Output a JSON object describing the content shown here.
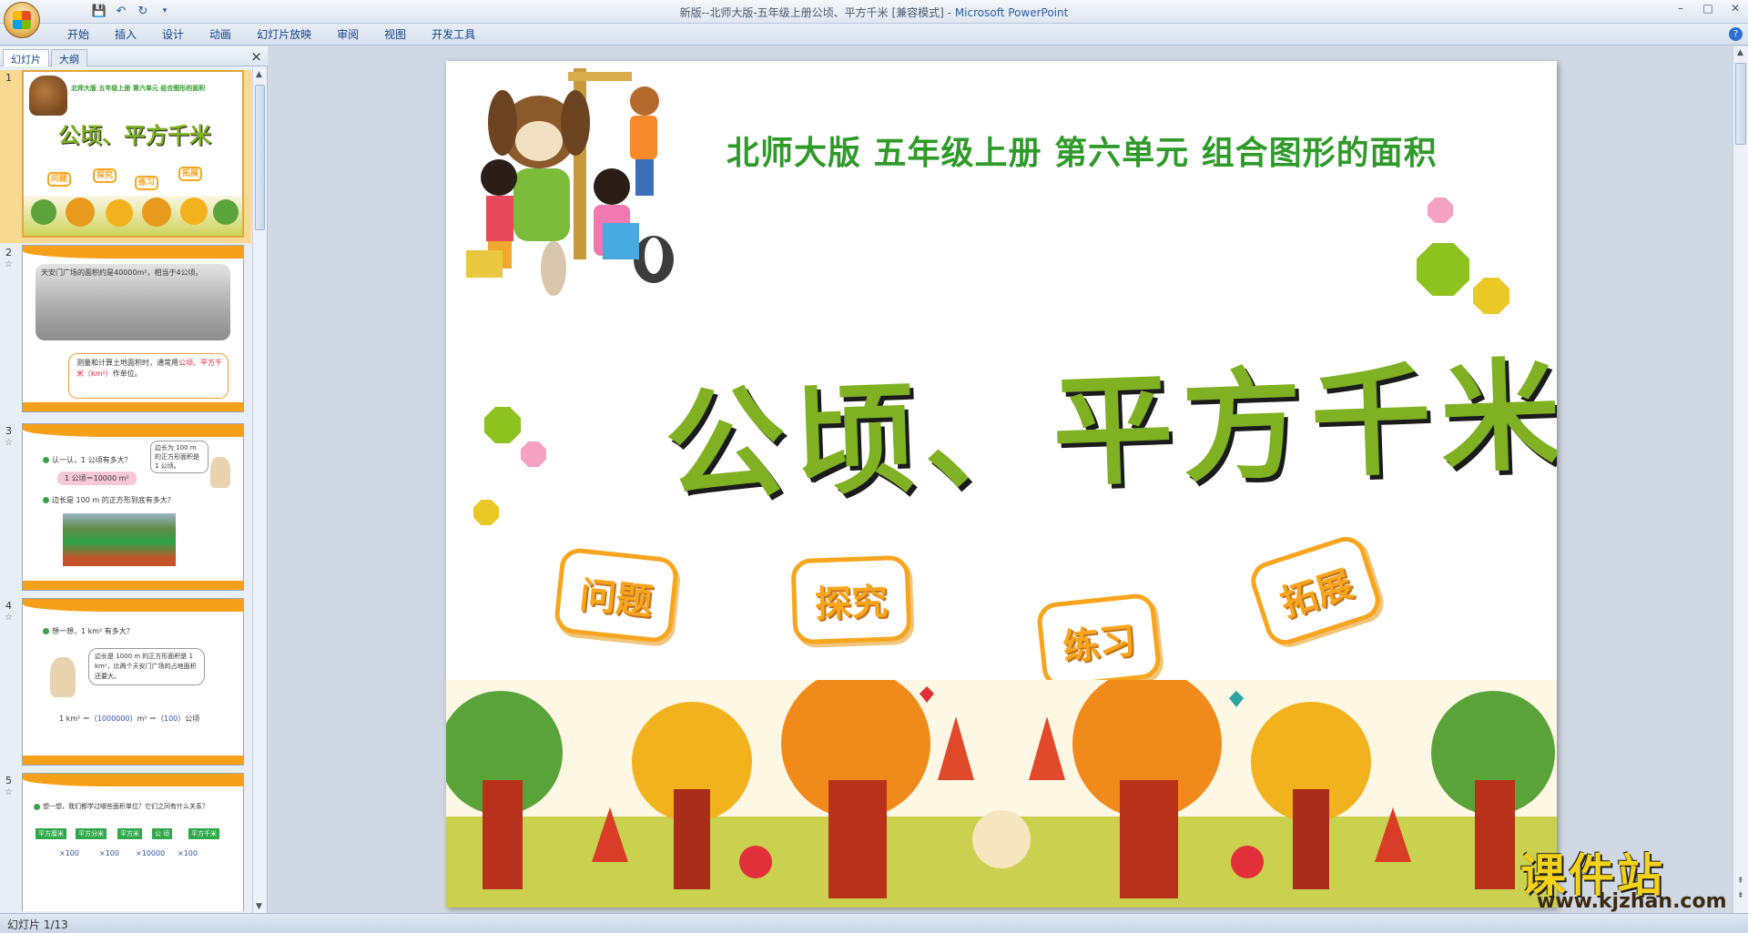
{
  "window": {
    "title_doc": "新版--北师大版-五年级上册公顷、平方千米 [兼容模式] - ",
    "title_app": "Microsoft PowerPoint"
  },
  "quick_access": {
    "save_icon": "save-icon",
    "undo_icon": "undo-icon",
    "redo_icon": "redo-icon",
    "customize_icon": "dropdown-icon"
  },
  "ribbon": {
    "tabs": [
      "开始",
      "插入",
      "设计",
      "动画",
      "幻灯片放映",
      "审阅",
      "视图",
      "开发工具"
    ],
    "help_icon": "?"
  },
  "panel": {
    "tab_slides": "幻灯片",
    "tab_outline": "大纲",
    "close": "×"
  },
  "thumbnails": [
    {
      "num": "1",
      "header": "北师大版 五年级上册 第六单元 组合图形的面积",
      "title": "公顷、平方千米",
      "badges": [
        "问题",
        "探究",
        "练习",
        "拓展"
      ]
    },
    {
      "num": "2",
      "text1": "天安门广场的面积约是40000m²，相当于4公顷。",
      "text2": "测量和计算土地面积时，通常用",
      "text2_red": "公顷、平方千米（km²）",
      "text3": "作单位。"
    },
    {
      "num": "3",
      "bullet1": "认一认，1 公顷有多大？",
      "pill": "1 公顷＝10000 m²",
      "bubble": "边长为 100 m 的正方形面积是 1 公顷。",
      "bullet2": "边长是 100 m 的正方形到底有多大？"
    },
    {
      "num": "4",
      "bullet1": "想一想，1 km² 有多大？",
      "bubble": "边长是 1000 m 的正方形面积是 1 km²，比两个天安门广场的占地面积还要大。",
      "formula_a": "1 km² ＝（",
      "formula_val1": "1000000",
      "formula_b": "）m² ＝（",
      "formula_val2": "100",
      "formula_c": "）公顷"
    },
    {
      "num": "5",
      "bullet1": "想一想，我们都学过哪些面积单位？它们之间有什么关系？",
      "units": [
        "平方厘米",
        "平方分米",
        "平方米",
        "公 顷",
        "平方千米"
      ],
      "factors": [
        "×100",
        "×100",
        "×10000",
        "×100"
      ]
    }
  ],
  "slide": {
    "header": "北师大版  五年级上册  第六单元  组合图形的面积",
    "title": "公顷、平方千米",
    "badges": [
      "问题",
      "探究",
      "练习",
      "拓展"
    ]
  },
  "status": {
    "slide_counter": "幻灯片 1/13"
  },
  "watermark": {
    "title": "课件站",
    "url": "www.kjzhan.com"
  },
  "colors": {
    "header_green": "#2f9a2a",
    "title_green": "#7fb123",
    "badge_orange": "#f7a51f",
    "thumb_orange": "#f6a01a",
    "selection": "#f7d991"
  }
}
